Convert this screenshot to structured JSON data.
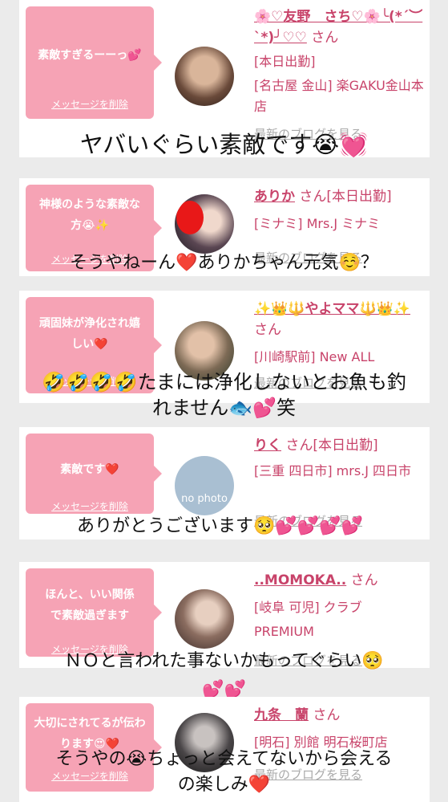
{
  "cards": [
    {
      "message": "素敵すぎるーーっ💕",
      "delete_label": "メッセージを削除",
      "name": "🌸♡友野　さち♡🌸╰(*´︶`*)╯♡♡",
      "san": "さん",
      "details": [
        "[本日出勤]",
        "[名古屋 金山] 楽GAKU金山本店"
      ],
      "blog_link": "最新のブログを見る",
      "overlay": "ヤバいぐらい素敵です😭💓"
    },
    {
      "message": "神様のような素敵な方😭✨",
      "delete_label": "メッセージを削除",
      "name": "ありか",
      "san": "さん[本日出勤]",
      "details": [
        "[ミナミ] Mrs.J ミナミ"
      ],
      "blog_link": "最新のブログを見る",
      "overlay": "そうやねーん❤️ありかちゃん元気☺️？"
    },
    {
      "message": "頑固妹が浄化され嬉しい❤️",
      "delete_label": "メッセージを削除",
      "name": "✨👑🔱やよママ🔱👑✨",
      "san": "さん",
      "details": [
        "[川崎駅前] New ALL"
      ],
      "blog_link": "最新のブログを見る",
      "overlay_line1": "🤣🤣🤣🤣たまには浄化しないとお魚も釣",
      "overlay_line2": "れません🐟💕笑"
    },
    {
      "message": "素敵です❤️",
      "delete_label": "メッセージを削除",
      "name": "りく",
      "san": "さん[本日出勤]",
      "details": [
        "[三重 四日市] mrs.J 四日市"
      ],
      "avatar_text": "no photo",
      "blog_link": "最新のブログを見る",
      "overlay": "ありがとうございます🥺💕💕💕💕"
    },
    {
      "message": "ほんと、いい関係で素敵過ぎます",
      "delete_label": "メッセージを削除",
      "name": "..MOMOKA..",
      "san": "さん",
      "details": [
        "[岐阜 可児] クラブ",
        "PREMIUM"
      ],
      "blog_link": "最新のブログを見る",
      "overlay_line1": "ＮＯと言われた事ないかもってぐらい🥺",
      "overlay_line2": "💕💕"
    },
    {
      "message": "大切にされてるが伝わります😍❤️",
      "delete_label": "メッセージを削除",
      "name": "九条　蘭",
      "san": "さん",
      "details": [
        "[明石] 別館 明石桜町店"
      ],
      "blog_link": "最新のブログを見る",
      "overlay_line1": "そうやの😭ちょっと会えてないから会える",
      "overlay_line2": "の楽しみ❤️"
    }
  ]
}
